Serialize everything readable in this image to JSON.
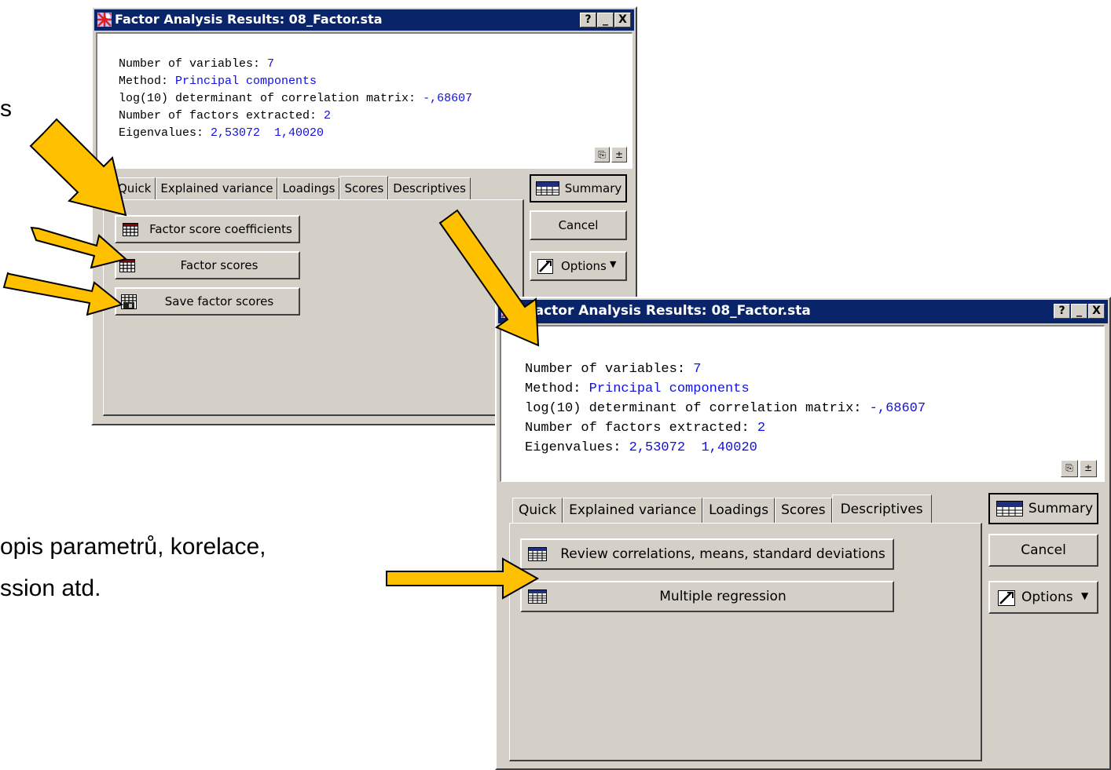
{
  "slide": {
    "fragment_s": "s",
    "text_line1": "opis parametrů, korelace,",
    "text_line2": "ssion atd."
  },
  "dialog1": {
    "title": "Factor Analysis Results: 08_Factor.sta",
    "title_buttons": [
      "?",
      "_",
      "X"
    ],
    "output": {
      "l1_label": "Number of variables: ",
      "l1_value": "7",
      "l2_label": "Method: ",
      "l2_value": "Principal components",
      "l3_label": "log(10) determinant of correlation matrix: ",
      "l3_value": "-,68607",
      "l4_label": "Number of factors extracted: ",
      "l4_value": "2",
      "l5_label": "Eigenvalues: ",
      "l5_value": "2,53072  1,40020"
    },
    "tabs": [
      "Quick",
      "Explained variance",
      "Loadings",
      "Scores",
      "Descriptives"
    ],
    "active_tab": "Scores",
    "buttons": {
      "factor_score_coefficients": "Factor score coefficients",
      "factor_scores": "Factor scores",
      "save_factor_scores": "Save factor scores"
    },
    "side": {
      "summary": "Summary",
      "cancel": "Cancel",
      "options": "Options"
    }
  },
  "dialog2": {
    "title": "Factor Analysis Results: 08_Factor.sta",
    "title_buttons": [
      "?",
      "_",
      "X"
    ],
    "output": {
      "l1_label": "Number of variables: ",
      "l1_value": "7",
      "l2_label": "Method: ",
      "l2_value": "Principal components",
      "l3_label": "log(10) determinant of correlation matrix: ",
      "l3_value": "-,68607",
      "l4_label": "Number of factors extracted: ",
      "l4_value": "2",
      "l5_label": "Eigenvalues: ",
      "l5_value": "2,53072  1,40020"
    },
    "tabs": [
      "Quick",
      "Explained variance",
      "Loadings",
      "Scores",
      "Descriptives"
    ],
    "active_tab": "Descriptives",
    "buttons": {
      "review_correlations": "Review correlations, means, standard deviations",
      "multiple_regression": "Multiple regression"
    },
    "side": {
      "summary": "Summary",
      "cancel": "Cancel",
      "options": "Options"
    }
  },
  "colors": {
    "arrow_fill": "#ffc000",
    "titlebar": "#0a246a",
    "value_text": "#1010e0",
    "face": "#d4d0c8"
  },
  "icons": [
    "statistica-app-icon",
    "grid-table-icon",
    "save-disk-icon",
    "summary-table-icon",
    "options-icon",
    "copy-icon",
    "expand-icon",
    "yellow-arrow"
  ]
}
